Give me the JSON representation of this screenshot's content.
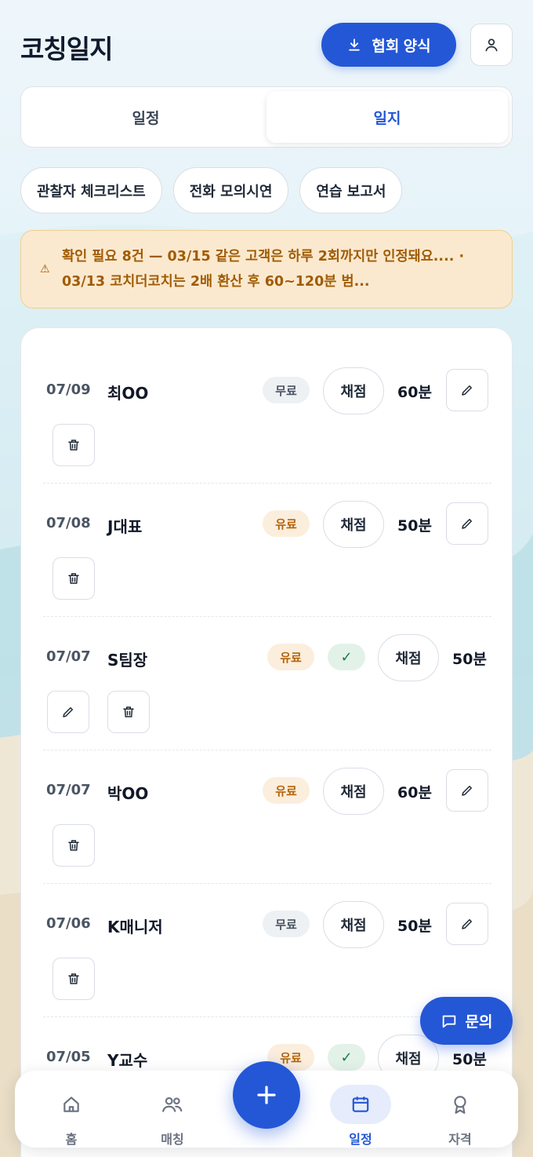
{
  "header": {
    "title": "코칭일지",
    "download_label": "협회 양식"
  },
  "segment": {
    "tabs": [
      {
        "label": "일정",
        "active": false
      },
      {
        "label": "일지",
        "active": true
      }
    ]
  },
  "chips": [
    "관찰자 체크리스트",
    "전화 모의시연",
    "연습 보고서"
  ],
  "alert": {
    "line1": "확인 필요 8건 — 03/15 같은 고객은 하루 2회까지만 인정돼요.... ·",
    "line2": "03/13 코치더코치는 2배 환산 후 60~120분 범..."
  },
  "grade_label": "채점",
  "entries": [
    {
      "date": "07/09",
      "name": "최OO",
      "type": "무료",
      "checked": false,
      "duration": "60분"
    },
    {
      "date": "07/08",
      "name": "J대표",
      "type": "유료",
      "checked": false,
      "duration": "50분"
    },
    {
      "date": "07/07",
      "name": "S팀장",
      "type": "유료",
      "checked": true,
      "duration": "50분"
    },
    {
      "date": "07/07",
      "name": "박OO",
      "type": "유료",
      "checked": false,
      "duration": "60분"
    },
    {
      "date": "07/06",
      "name": "K매니저",
      "type": "무료",
      "checked": false,
      "duration": "50분"
    },
    {
      "date": "07/05",
      "name": "Y교수",
      "type": "유료",
      "checked": true,
      "duration": "50분"
    }
  ],
  "ask_label": "문의",
  "nav": {
    "items": [
      {
        "label": "홈",
        "icon": "home-icon"
      },
      {
        "label": "매칭",
        "icon": "people-icon"
      },
      {
        "label": "일정",
        "icon": "calendar-icon",
        "active": true
      },
      {
        "label": "자격",
        "icon": "award-icon"
      }
    ]
  },
  "colors": {
    "primary": "#2457d6",
    "alert_bg": "#fbe9cf",
    "alert_text": "#a05c05"
  }
}
